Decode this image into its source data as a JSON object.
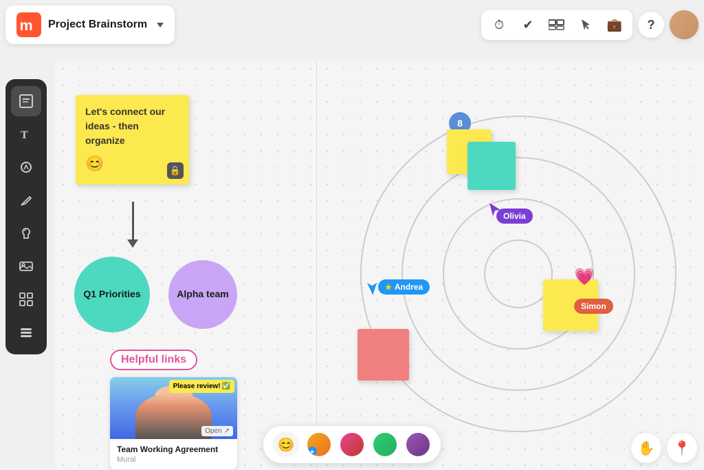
{
  "app": {
    "logo_text": "M",
    "project_title": "Project Brainstorm",
    "chevron_label": "▼"
  },
  "toolbar": {
    "icons": [
      "⏱",
      "✓",
      "👓",
      "✦",
      "🗂"
    ],
    "help_label": "?",
    "avatar_label": "User avatar"
  },
  "sidebar": {
    "icons": [
      "📋",
      "T",
      "⬡",
      "✏",
      "🦙",
      "🖼",
      "⊞",
      "≡"
    ]
  },
  "canvas_left": {
    "sticky_note": {
      "text": "Let's connect our ideas - then organize",
      "emoji": "😊"
    },
    "circles": [
      {
        "label": "Q1\nPriorities"
      },
      {
        "label": "Alpha\nteam"
      }
    ],
    "helpful_links": {
      "label": "Helpful links",
      "card_title": "Team Working Agreement",
      "card_source": "Mural",
      "card_open": "Open",
      "please_review": "Please review!"
    }
  },
  "canvas_right": {
    "badge_number": "8",
    "users": [
      {
        "name": "Olivia",
        "color": "#7b3fd4"
      },
      {
        "name": "Simon",
        "color": "#e06040"
      },
      {
        "name": "Andrea",
        "color": "#2196F3"
      }
    ]
  },
  "bottom_bar": {
    "emoji_btn": "😊",
    "participants": [
      "P1",
      "P2",
      "P3",
      "P4"
    ],
    "star_label": "★"
  },
  "bottom_right": {
    "hand_icon": "✋",
    "location_icon": "📍"
  }
}
